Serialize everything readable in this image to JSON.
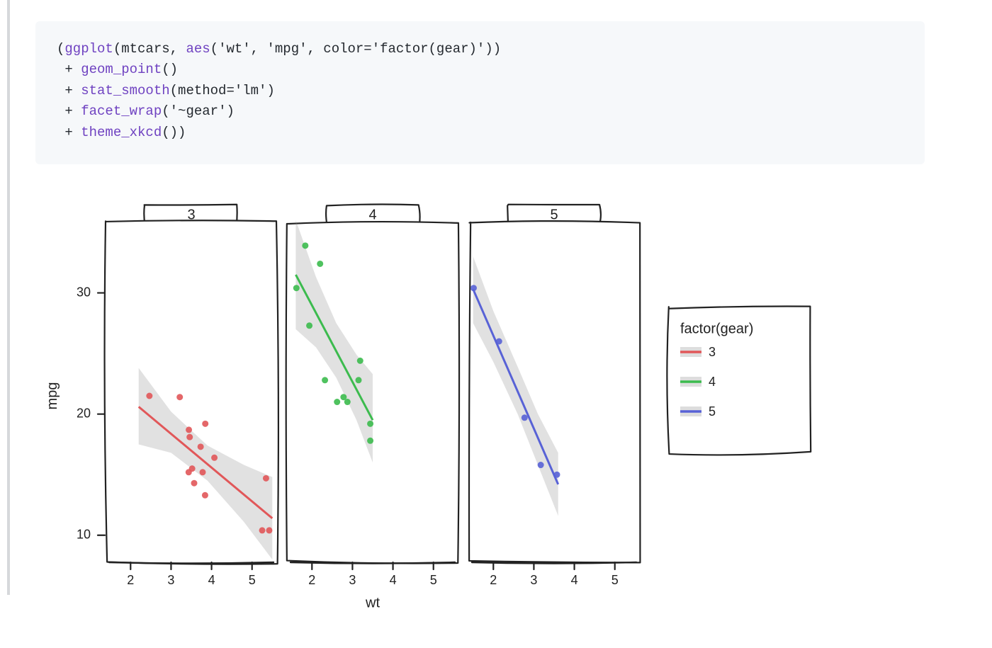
{
  "code": {
    "line1_open": "(",
    "line1_fn": "ggplot",
    "line1_args_open": "(mtcars, ",
    "line1_aes": "aes",
    "line1_aes_args": "('wt', 'mpg', color='factor(gear)'))",
    "line2_plus": " + ",
    "line2_fn": "geom_point",
    "line2_rest": "()",
    "line3_plus": " + ",
    "line3_fn": "stat_smooth",
    "line3_rest": "(method='lm')",
    "line4_plus": " + ",
    "line4_fn": "facet_wrap",
    "line4_rest": "('~gear')",
    "line5_plus": " + ",
    "line5_fn": "theme_xkcd",
    "line5_rest": "())"
  },
  "chart_data": {
    "type": "scatter",
    "facets": [
      "3",
      "4",
      "5"
    ],
    "xlabel": "wt",
    "ylabel": "mpg",
    "xlim": [
      1.4,
      5.6
    ],
    "ylim": [
      8,
      35
    ],
    "xticks": [
      2,
      3,
      4,
      5
    ],
    "yticks": [
      10,
      20,
      30
    ],
    "legend_title": "factor(gear)",
    "series": [
      {
        "name": "3",
        "color": "#e15759",
        "points": [
          {
            "x": 2.465,
            "y": 21.5
          },
          {
            "x": 3.215,
            "y": 21.4
          },
          {
            "x": 3.435,
            "y": 15.2
          },
          {
            "x": 3.44,
            "y": 18.7
          },
          {
            "x": 3.46,
            "y": 18.1
          },
          {
            "x": 3.52,
            "y": 15.5
          },
          {
            "x": 3.57,
            "y": 14.3
          },
          {
            "x": 3.73,
            "y": 17.3
          },
          {
            "x": 3.78,
            "y": 15.2
          },
          {
            "x": 3.84,
            "y": 13.3
          },
          {
            "x": 3.845,
            "y": 19.2
          },
          {
            "x": 4.07,
            "y": 16.4
          },
          {
            "x": 5.25,
            "y": 10.4
          },
          {
            "x": 5.345,
            "y": 14.7
          },
          {
            "x": 5.424,
            "y": 10.4
          }
        ],
        "fit": {
          "x0": 2.2,
          "y0": 20.6,
          "x1": 5.5,
          "y1": 11.4
        },
        "ci": [
          {
            "x": 2.2,
            "lo": 17.5,
            "hi": 23.8
          },
          {
            "x": 3.0,
            "lo": 16.8,
            "hi": 20.2
          },
          {
            "x": 3.9,
            "lo": 14.5,
            "hi": 17.4
          },
          {
            "x": 4.8,
            "lo": 11.1,
            "hi": 15.8
          },
          {
            "x": 5.5,
            "lo": 8.0,
            "hi": 14.8
          }
        ]
      },
      {
        "name": "4",
        "color": "#3cbb4e",
        "points": [
          {
            "x": 1.615,
            "y": 30.4
          },
          {
            "x": 1.835,
            "y": 33.9
          },
          {
            "x": 1.935,
            "y": 27.3
          },
          {
            "x": 2.2,
            "y": 32.4
          },
          {
            "x": 2.32,
            "y": 22.8
          },
          {
            "x": 2.62,
            "y": 21.0
          },
          {
            "x": 2.78,
            "y": 21.4
          },
          {
            "x": 2.875,
            "y": 21.0
          },
          {
            "x": 3.15,
            "y": 22.8
          },
          {
            "x": 3.19,
            "y": 24.4
          },
          {
            "x": 3.44,
            "y": 19.2
          },
          {
            "x": 3.44,
            "y": 17.8
          }
        ],
        "fit": {
          "x0": 1.6,
          "y0": 31.5,
          "x1": 3.5,
          "y1": 19.5
        },
        "ci": [
          {
            "x": 1.6,
            "lo": 27.0,
            "hi": 36.0
          },
          {
            "x": 2.1,
            "lo": 25.5,
            "hi": 31.3
          },
          {
            "x": 2.6,
            "lo": 23.0,
            "hi": 27.5
          },
          {
            "x": 3.1,
            "lo": 19.5,
            "hi": 24.9
          },
          {
            "x": 3.5,
            "lo": 16.0,
            "hi": 23.3
          }
        ]
      },
      {
        "name": "5",
        "color": "#5862d6",
        "points": [
          {
            "x": 1.513,
            "y": 30.4
          },
          {
            "x": 2.14,
            "y": 26.0
          },
          {
            "x": 2.77,
            "y": 19.7
          },
          {
            "x": 3.17,
            "y": 15.8
          },
          {
            "x": 3.57,
            "y": 15.0
          }
        ],
        "fit": {
          "x0": 1.5,
          "y0": 30.3,
          "x1": 3.6,
          "y1": 14.2
        },
        "ci": [
          {
            "x": 1.5,
            "lo": 27.5,
            "hi": 33.0
          },
          {
            "x": 2.0,
            "lo": 24.3,
            "hi": 28.5
          },
          {
            "x": 2.6,
            "lo": 20.0,
            "hi": 23.9
          },
          {
            "x": 3.1,
            "lo": 15.8,
            "hi": 20.0
          },
          {
            "x": 3.6,
            "lo": 11.6,
            "hi": 16.8
          }
        ]
      }
    ]
  }
}
